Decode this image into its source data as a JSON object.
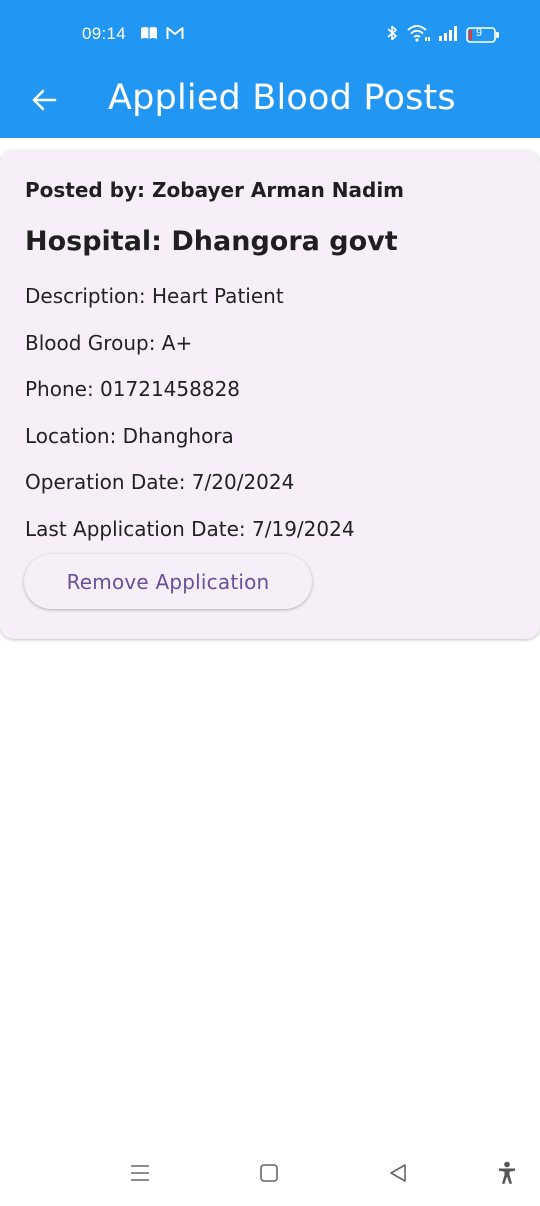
{
  "status_bar": {
    "time": "09:14",
    "battery_level": "9",
    "left_icons": [
      "book-icon",
      "gmail-icon"
    ],
    "right_icons": [
      "bluetooth-icon",
      "wifi-icon",
      "signal-icon",
      "battery-icon"
    ]
  },
  "app_bar": {
    "title": "Applied Blood Posts",
    "back_icon": "arrow-left-icon",
    "background": "#2196F3"
  },
  "post": {
    "posted_by": "Posted by: Zobayer Arman Nadim",
    "hospital": "Hospital: Dhangora govt",
    "description": "Description: Heart Patient",
    "blood_group": "Blood Group: A+",
    "phone": "Phone: 01721458828",
    "location": "Location: Dhanghora",
    "operation_date": "Operation Date: 7/20/2024",
    "last_application_date": "Last Application Date: 7/19/2024",
    "remove_button_label": "Remove Application",
    "card_color": "#f6eff8",
    "button_text_color": "#6a4f9a"
  },
  "nav_bar": {
    "items": [
      "recents-icon",
      "home-icon",
      "back-triangle-icon",
      "accessibility-icon"
    ]
  }
}
